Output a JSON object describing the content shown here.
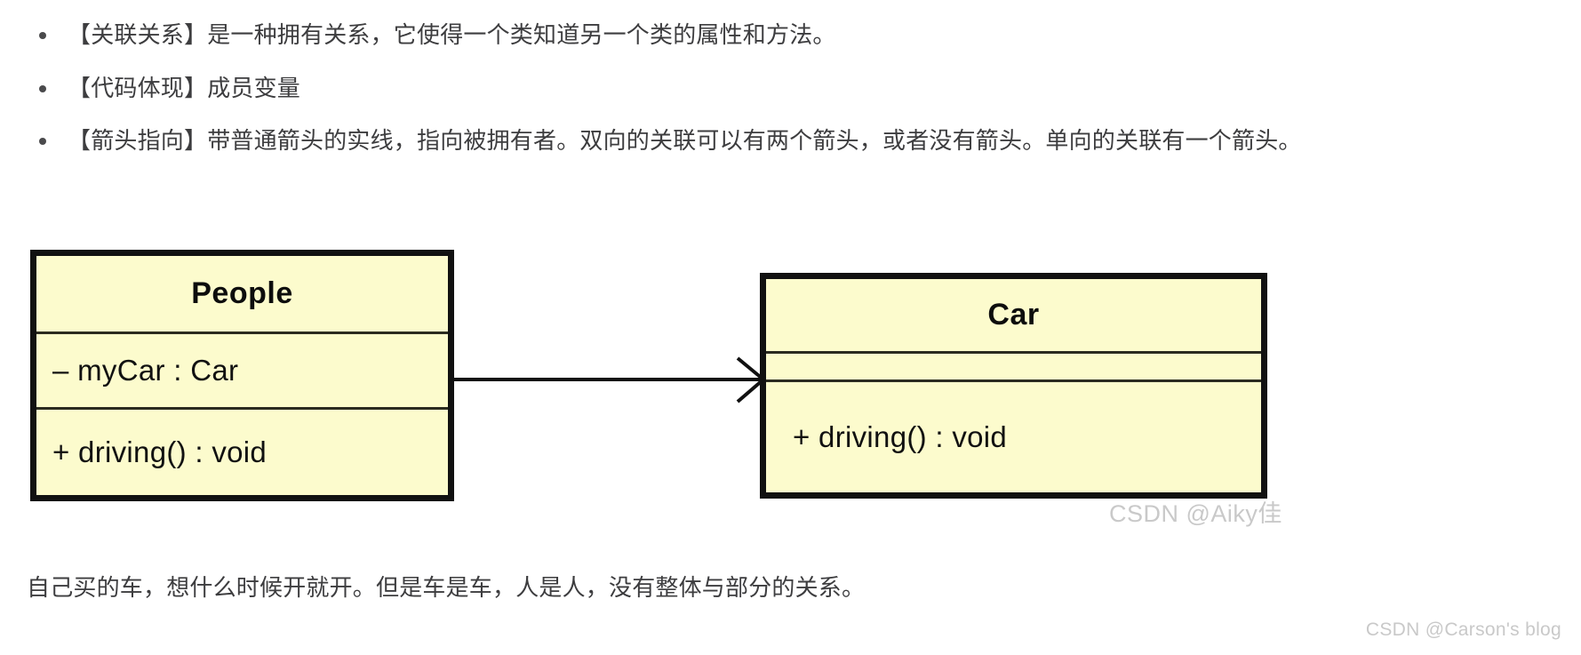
{
  "document": {
    "bullets": [
      "【关联关系】是一种拥有关系，它使得一个类知道另一个类的属性和方法。",
      "【代码体现】成员变量",
      "【箭头指向】带普通箭头的实线，指向被拥有者。双向的关联可以有两个箭头，或者没有箭头。单向的关联有一个箭头。"
    ],
    "caption": "自己买的车，想什么时候开就开。但是车是车，人是人，没有整体与部分的关系。"
  },
  "diagram": {
    "type": "uml-class-diagram",
    "relationship": "association",
    "fill_color": "#FCFBCD",
    "border_color": "#111111",
    "classes": [
      {
        "name": "People",
        "attributes": [
          "– myCar : Car"
        ],
        "methods": [
          "+ driving() : void"
        ]
      },
      {
        "name": "Car",
        "attributes": [
          ""
        ],
        "methods": [
          "+ driving() : void"
        ]
      }
    ],
    "connector": {
      "kind": "association-arrow",
      "style": "solid-line-open-arrowhead",
      "from": "People",
      "to": "Car"
    }
  },
  "watermarks": {
    "inner": "CSDN @Aiky佳",
    "corner": "CSDN @Carson's  blog"
  }
}
